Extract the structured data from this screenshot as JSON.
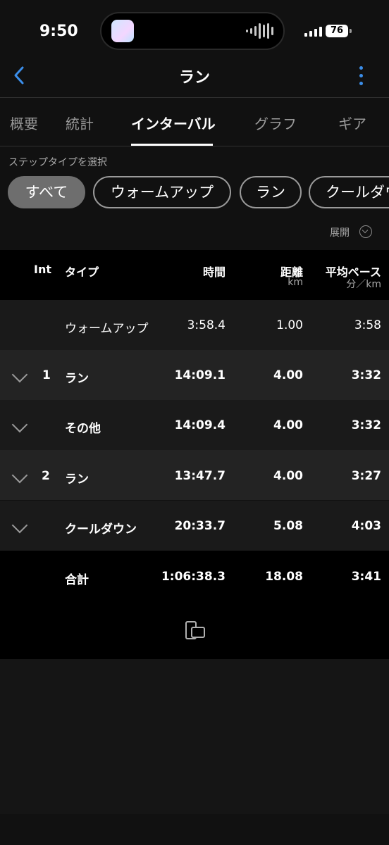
{
  "status": {
    "time": "9:50",
    "battery": "76"
  },
  "header": {
    "title": "ラン"
  },
  "tabs": [
    "概要",
    "統計",
    "インターバル",
    "グラフ",
    "ギア"
  ],
  "filter": {
    "label": "ステップタイプを選択",
    "chips": [
      "すべて",
      "ウォームアップ",
      "ラン",
      "クールダウ"
    ]
  },
  "expand_label": "展開",
  "table": {
    "headers": {
      "int": "Int",
      "type": "タイプ",
      "time": "時間",
      "distance": "距離",
      "distance_unit": "km",
      "pace": "平均ペース",
      "pace_unit": "分／km"
    },
    "rows": [
      {
        "int": "",
        "type": "ウォームアップ",
        "time": "3:58.4",
        "distance": "1.00",
        "pace": "3:58"
      },
      {
        "int": "1",
        "type": "ラン",
        "time": "14:09.1",
        "distance": "4.00",
        "pace": "3:32"
      },
      {
        "int": "",
        "type": "その他",
        "time": "14:09.4",
        "distance": "4.00",
        "pace": "3:32"
      },
      {
        "int": "2",
        "type": "ラン",
        "time": "13:47.7",
        "distance": "4.00",
        "pace": "3:27"
      },
      {
        "int": "",
        "type": "クールダウン",
        "time": "20:33.7",
        "distance": "5.08",
        "pace": "4:03"
      }
    ],
    "total": {
      "type": "合計",
      "time": "1:06:38.3",
      "distance": "18.08",
      "pace": "3:41"
    }
  },
  "colors": {
    "accent": "#3b8eea",
    "background": "#111111",
    "row_dark": "#1a1a1a",
    "row_light": "#232323"
  }
}
